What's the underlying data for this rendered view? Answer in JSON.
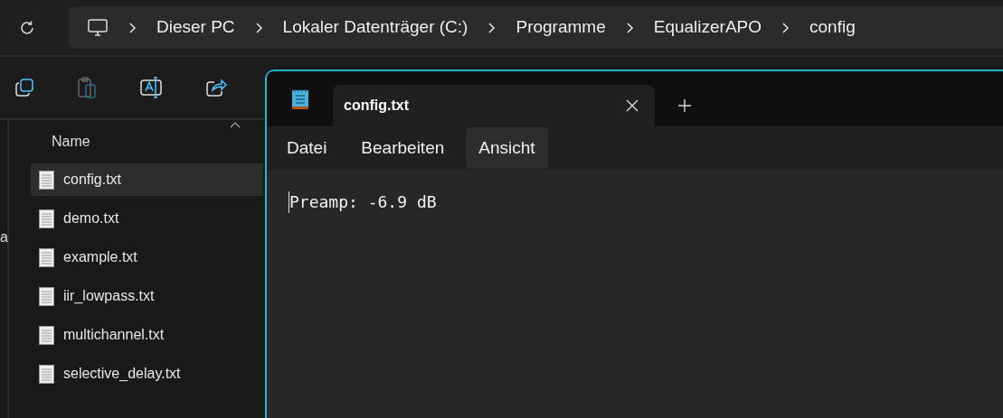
{
  "address_bar": {
    "breadcrumb": [
      "Dieser PC",
      "Lokaler Datenträger (C:)",
      "Programme",
      "EqualizerAPO",
      "config"
    ]
  },
  "nav_pane_fragment": "a",
  "file_list": {
    "column_header": "Name",
    "files": [
      {
        "name": "config.txt",
        "selected": true
      },
      {
        "name": "demo.txt",
        "selected": false
      },
      {
        "name": "example.txt",
        "selected": false
      },
      {
        "name": "iir_lowpass.txt",
        "selected": false
      },
      {
        "name": "multichannel.txt",
        "selected": false
      },
      {
        "name": "selective_delay.txt",
        "selected": false
      }
    ]
  },
  "notepad": {
    "tab_title": "config.txt",
    "menu": [
      {
        "label": "Datei",
        "selected": false
      },
      {
        "label": "Bearbeiten",
        "selected": false
      },
      {
        "label": "Ansicht",
        "selected": true
      }
    ],
    "content": "Preamp: -6.9 dB"
  }
}
